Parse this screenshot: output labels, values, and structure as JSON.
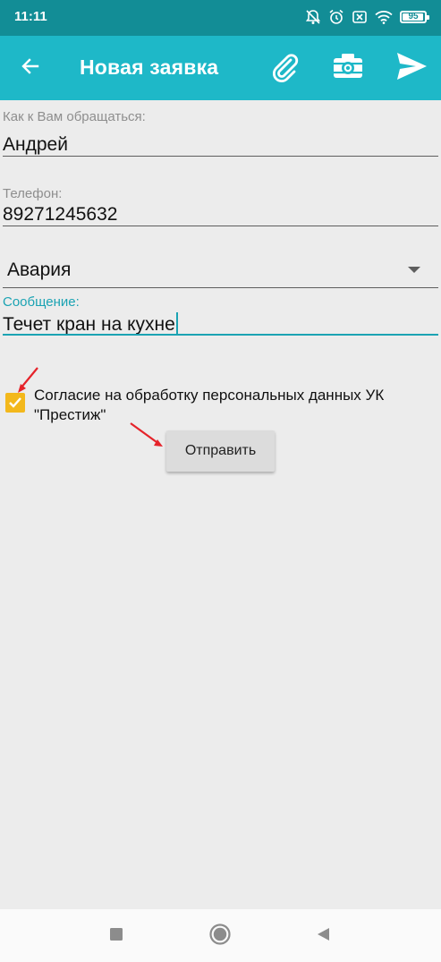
{
  "status_bar": {
    "time": "11:11",
    "battery_level": "95",
    "battery_fraction": 0.95,
    "icons": [
      "notifications-muted-icon",
      "alarm-icon",
      "sim-off-icon",
      "wifi-icon",
      "battery-icon"
    ]
  },
  "toolbar": {
    "title": "Новая заявка",
    "color": "#1eb8c8",
    "icons": [
      "back-arrow-icon",
      "paperclip-icon",
      "camera-icon",
      "send-icon"
    ]
  },
  "form": {
    "name": {
      "label": "Как к Вам обращаться:",
      "value": "Андрей"
    },
    "phone": {
      "label": "Телефон:",
      "value": "89271245632"
    },
    "category": {
      "value": "Авария"
    },
    "message": {
      "label": "Сообщение:",
      "value": "Течет кран на кухне"
    },
    "consent": {
      "checked": true,
      "text": "Согласие на обработку персональных данных УК \"Престиж\""
    },
    "submit_label": "Отправить"
  },
  "colors": {
    "accent": "#1ba3b3",
    "checkbox": "#f3b81c",
    "annotation_arrow": "#e5232a"
  },
  "nav_bar": {
    "icons": [
      "recent-apps-icon",
      "home-icon",
      "back-icon"
    ]
  }
}
